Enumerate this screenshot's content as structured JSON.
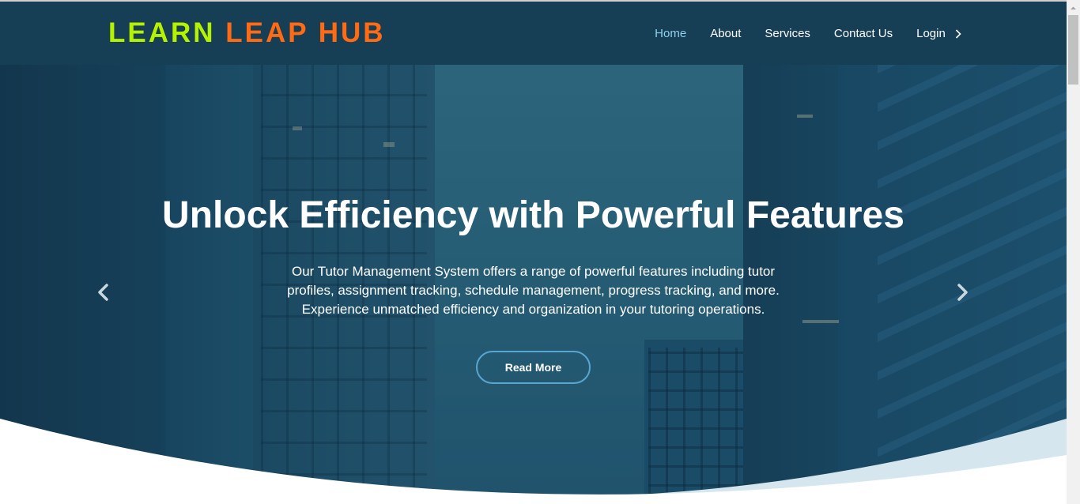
{
  "brand": {
    "part1": "LEARN",
    "part2": "LEAP HUB",
    "color1": "#b5f200",
    "color2": "#ff6a13"
  },
  "nav": {
    "items": [
      {
        "label": "Home",
        "active": true
      },
      {
        "label": "About"
      },
      {
        "label": "Services"
      },
      {
        "label": "Contact Us"
      },
      {
        "label": "Login",
        "icon": "chevron-right-icon"
      }
    ]
  },
  "hero": {
    "title": "Unlock Efficiency with Powerful Features",
    "description": "Our Tutor Management System offers a range of powerful features including tutor profiles, assignment tracking, schedule management, progress tracking, and more. Experience unmatched efficiency and organization in your tutoring operations.",
    "button_label": "Read More",
    "prev_icon": "chevron-left-icon",
    "next_icon": "chevron-right-icon"
  },
  "colors": {
    "navbar": "#163e52",
    "accent": "#5aa6d1",
    "active_link": "#8fd0ee",
    "wave": "#d5e6ef"
  }
}
